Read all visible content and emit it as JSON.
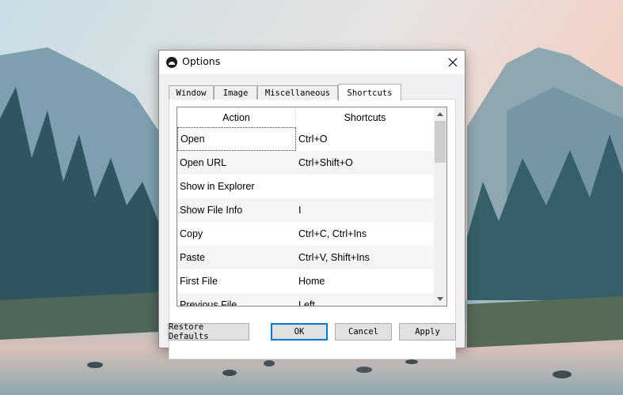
{
  "window": {
    "title": "Options",
    "close_icon": "close-icon",
    "app_icon": "options-app-icon"
  },
  "tabs": [
    {
      "label": "Window"
    },
    {
      "label": "Image"
    },
    {
      "label": "Miscellaneous"
    },
    {
      "label": "Shortcuts",
      "active": true
    }
  ],
  "table": {
    "columns": [
      "Action",
      "Shortcuts"
    ],
    "rows": [
      {
        "action": "Open",
        "shortcut": "Ctrl+O"
      },
      {
        "action": "Open URL",
        "shortcut": "Ctrl+Shift+O"
      },
      {
        "action": "Show in Explorer",
        "shortcut": ""
      },
      {
        "action": "Show File Info",
        "shortcut": "I"
      },
      {
        "action": "Copy",
        "shortcut": "Ctrl+C, Ctrl+Ins"
      },
      {
        "action": "Paste",
        "shortcut": "Ctrl+V, Shift+Ins"
      },
      {
        "action": "First File",
        "shortcut": "Home"
      },
      {
        "action": "Previous File",
        "shortcut": "Left"
      }
    ]
  },
  "buttons": {
    "restore_defaults": "Restore Defaults",
    "ok": "OK",
    "cancel": "Cancel",
    "apply": "Apply"
  },
  "colors": {
    "default_button_border": "#0078d7",
    "row_alt": "#f5f5f5"
  }
}
